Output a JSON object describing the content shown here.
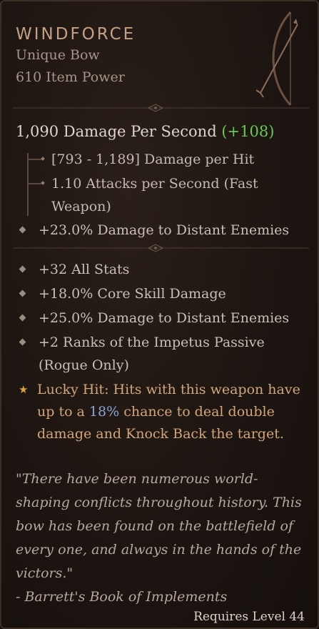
{
  "item": {
    "name": "WINDFORCE",
    "type": "Unique Bow",
    "power": "610 Item Power"
  },
  "weapon": {
    "dps_value": "1,090 Damage Per Second",
    "dps_delta": "(+108)",
    "damage_per_hit": "[793 - 1,189] Damage per Hit",
    "attacks_line1": "1.10 Attacks per Second (Fast",
    "attacks_line2": "Weapon)",
    "implicit": "+23.0% Damage to Distant Enemies"
  },
  "affixes": [
    "+32 All Stats",
    "+18.0% Core Skill Damage",
    "+25.0% Damage to Distant Enemies",
    "+2 Ranks of the Impetus Passive",
    "(Rogue Only)"
  ],
  "unique_power": {
    "prefix": "Lucky Hit: Hits with this weapon have up to a ",
    "highlight": "18%",
    "suffix": " chance to deal double damage and Knock Back the target."
  },
  "flavor": {
    "quote": "\"There have been numerous world-shaping conflicts throughout history. This bow has been found on the battlefield of every one, and always in the hands of the victors.\"",
    "source": "- Barrett's Book of Implements"
  },
  "requirement": "Requires Level 44",
  "colors": {
    "name": "#c4a184",
    "positive_delta": "#67c957",
    "unique_text": "#d3a57a",
    "highlight_number": "#8aa6d8",
    "star": "#e0a23c"
  },
  "icons": [
    "bow-icon",
    "divider-ornament-icon",
    "star-icon",
    "bullet-diamond-icon"
  ]
}
